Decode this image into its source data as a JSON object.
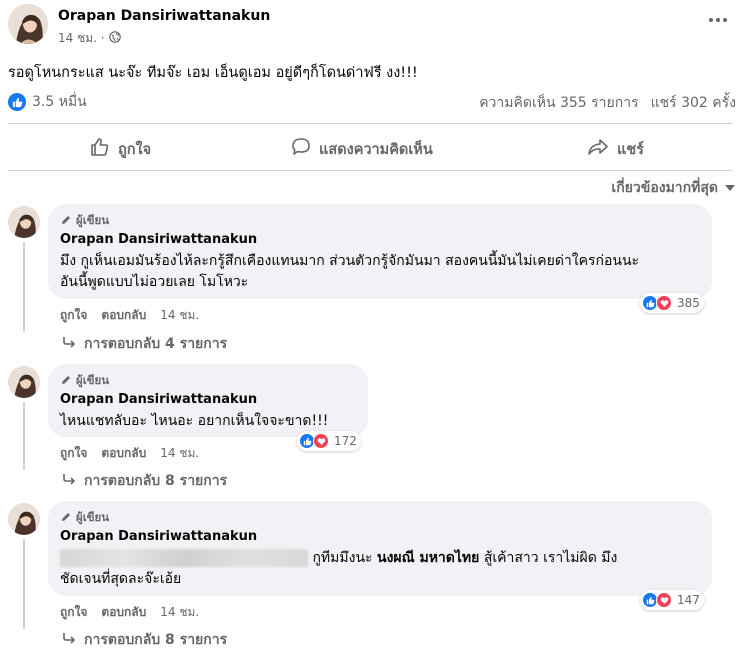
{
  "post": {
    "author": "Orapan Dansiriwattanakun",
    "time": "14 ชม. ·",
    "text": "รอดูโหนกระแส นะจ๊ะ ทีมจ๊ะ เอม เอ็นดูเอม อยู่ดีๆก็โดนด่าฟรี งง!!!",
    "reactions_count": "3.5 หมื่น",
    "comments_count": "ความคิดเห็น 355 รายการ",
    "shares_count": "แชร์ 302 ครั้ง"
  },
  "actions": {
    "like": "ถูกใจ",
    "comment": "แสดงความคิดเห็น",
    "share": "แชร์"
  },
  "sort_label": "เกี่ยวข้องมากที่สุด",
  "comments": [
    {
      "badge": "ผู้เขียน",
      "name": "Orapan Dansiriwattanakun",
      "line1": "มึง กูเห็นเอมมันร้องไห้ละกรู้สึกเคืองแทนมาก ส่วนตัวกรู้จักมันมา สองคนนี้มันไม่เคยด่าใครก่อนนะ",
      "line2": "อันนี้พูดแบบไม่อวยเลย โมโหวะ",
      "reactions": "385",
      "like": "ถูกใจ",
      "reply": "ตอบกลับ",
      "time": "14 ชม.",
      "replies": "การตอบกลับ 4 รายการ"
    },
    {
      "badge": "ผู้เขียน",
      "name": "Orapan Dansiriwattanakun",
      "line1": "ไหนแชทลับอะ ไหนอะ อยากเห็นใจจะขาด!!!",
      "reactions": "172",
      "like": "ถูกใจ",
      "reply": "ตอบกลับ",
      "time": "14 ชม.",
      "replies": "การตอบกลับ 8 รายการ"
    },
    {
      "badge": "ผู้เขียน",
      "name": "Orapan Dansiriwattanakun",
      "line1_after_blur": "กูทีมมึงนะ",
      "line1_bold": "นงผณี มหาดไทย",
      "line1_end": "สู้เค้าสาว เราไม่ผิด มึง",
      "line2": "ชัดเจนที่สุดละจ๊ะเอ้ย",
      "reactions": "147",
      "like": "ถูกใจ",
      "reply": "ตอบกลับ",
      "time": "14 ชม.",
      "replies": "การตอบกลับ 8 รายการ"
    }
  ],
  "colors": {
    "like": "#1877f2",
    "love": "#f33e58",
    "muted": "#65676b",
    "bubble": "#f0f2f5"
  },
  "icons": [
    "globe-icon",
    "more-dots-icon",
    "like-icon",
    "comment-icon",
    "share-icon",
    "chevron-down-icon",
    "pencil-icon",
    "reply-arrow-icon"
  ]
}
